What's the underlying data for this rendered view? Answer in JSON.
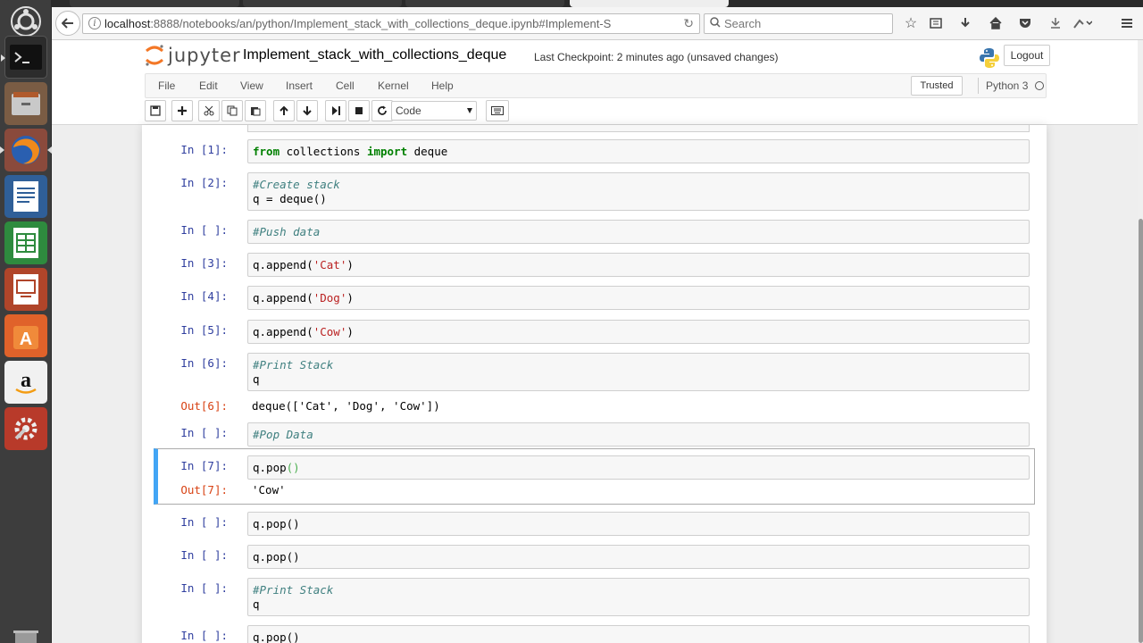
{
  "browser": {
    "url_host": "localhost",
    "url_rest": ":8888/notebooks/an/python/Implement_stack_with_collections_deque.ipynb#Implement-S",
    "search_placeholder": "Search"
  },
  "jupyter": {
    "logo_text": "jupyter",
    "notebook_title": "Implement_stack_with_collections_deque",
    "checkpoint": "Last Checkpoint: 2 minutes ago (unsaved changes)",
    "logout_label": "Logout",
    "menu": [
      "File",
      "Edit",
      "View",
      "Insert",
      "Cell",
      "Kernel",
      "Help"
    ],
    "trusted_label": "Trusted",
    "kernel_name": "Python 3",
    "cell_type": "Code"
  },
  "cells": [
    {
      "prompt": "In [1]:",
      "lines": [
        [
          {
            "t": "kw",
            "v": "from"
          },
          {
            "t": "n",
            "v": " collections "
          },
          {
            "t": "kw",
            "v": "import"
          },
          {
            "t": "n",
            "v": " deque"
          }
        ]
      ]
    },
    {
      "prompt": "In [2]:",
      "lines": [
        [
          {
            "t": "cm",
            "v": "#Create stack"
          }
        ],
        [
          {
            "t": "n",
            "v": "q = deque()"
          }
        ]
      ]
    },
    {
      "prompt": "In [ ]:",
      "lines": [
        [
          {
            "t": "cm",
            "v": "#Push data"
          }
        ]
      ]
    },
    {
      "prompt": "In [3]:",
      "lines": [
        [
          {
            "t": "n",
            "v": "q.append("
          },
          {
            "t": "st",
            "v": "'Cat'"
          },
          {
            "t": "n",
            "v": ")"
          }
        ]
      ]
    },
    {
      "prompt": "In [4]:",
      "lines": [
        [
          {
            "t": "n",
            "v": "q.append("
          },
          {
            "t": "st",
            "v": "'Dog'"
          },
          {
            "t": "n",
            "v": ")"
          }
        ]
      ]
    },
    {
      "prompt": "In [5]:",
      "lines": [
        [
          {
            "t": "n",
            "v": "q.append("
          },
          {
            "t": "st",
            "v": "'Cow'"
          },
          {
            "t": "n",
            "v": ")"
          }
        ]
      ]
    },
    {
      "prompt": "In [6]:",
      "lines": [
        [
          {
            "t": "cm",
            "v": "#Print Stack"
          }
        ],
        [
          {
            "t": "n",
            "v": "q"
          }
        ]
      ],
      "out_prompt": "Out[6]:",
      "output": "deque(['Cat', 'Dog', 'Cow'])"
    },
    {
      "prompt": "In [ ]:",
      "lines": [
        [
          {
            "t": "cm",
            "v": "#Pop Data"
          }
        ]
      ]
    },
    {
      "prompt": "In [7]:",
      "lines": [
        [
          {
            "t": "n",
            "v": "q.pop"
          },
          {
            "t": "kw2",
            "v": "()"
          }
        ]
      ],
      "out_prompt": "Out[7]:",
      "output": "'Cow'"
    },
    {
      "prompt": "In [ ]:",
      "lines": [
        [
          {
            "t": "n",
            "v": "q.pop()"
          }
        ]
      ]
    },
    {
      "prompt": "In [ ]:",
      "lines": [
        [
          {
            "t": "n",
            "v": "q.pop()"
          }
        ]
      ]
    },
    {
      "prompt": "In [ ]:",
      "lines": [
        [
          {
            "t": "cm",
            "v": "#Print Stack"
          }
        ],
        [
          {
            "t": "n",
            "v": "q"
          }
        ]
      ]
    },
    {
      "prompt": "In [ ]:",
      "lines": [
        [
          {
            "t": "n",
            "v": "q.pop()"
          }
        ]
      ]
    }
  ],
  "colors": {
    "in_prompt": "#303f9f",
    "out_prompt": "#d84315",
    "selected_border": "#42a5f5",
    "keyword": "#008000",
    "comment": "#408080",
    "string": "#ba2121"
  }
}
